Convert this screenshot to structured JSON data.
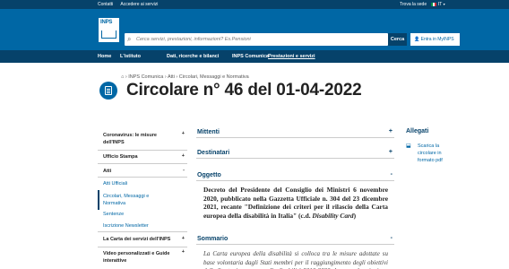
{
  "topbar": {
    "links": [
      "Contatti",
      "Accedere ai servizi"
    ],
    "right": "Trova la sede",
    "lang": "IT"
  },
  "header": {
    "logo_text": "INPS",
    "search_placeholder": "Cerca servizi, prestazioni, informazioni? Es.Pensioni",
    "search_button": "Cerca",
    "login_button": "Entra in MyINPS"
  },
  "nav": {
    "items": [
      "Home",
      "L'istituto",
      "Dati, ricerche e bilanci",
      "INPS Comunica",
      "Prestazioni e servizi"
    ]
  },
  "breadcrumb": [
    "INPS Comunica",
    "Atti",
    "Circolari, Messaggi e Normativa"
  ],
  "page_title": "Circolare n° 46 del 01-04-2022",
  "sidebar": {
    "items": [
      {
        "label": "Coronavirus: le misure dell'INPS",
        "type": "bold",
        "toggle": "+"
      },
      {
        "label": "Ufficio Stampa",
        "type": "bold",
        "toggle": "+"
      },
      {
        "label": "Atti",
        "type": "bold",
        "toggle": "-"
      },
      {
        "label": "Atti Ufficiali",
        "type": "sub"
      },
      {
        "label": "Circolari, Messaggi e Normativa",
        "type": "sub"
      },
      {
        "label": "Sentenze",
        "type": "sub"
      },
      {
        "label": "Iscrizione Newsletter",
        "type": "sub"
      },
      {
        "label": "La Carta dei servizi dell'INPS",
        "type": "bold",
        "toggle": "+"
      },
      {
        "label": "Video personalizzati e Guide interattive",
        "type": "bold",
        "toggle": "+"
      }
    ]
  },
  "sections": [
    {
      "label": "Mittenti",
      "toggle": "+"
    },
    {
      "label": "Destinatari",
      "toggle": "+"
    },
    {
      "label": "Oggetto",
      "toggle": "-"
    },
    {
      "label": "Sommario",
      "toggle": "-"
    }
  ],
  "oggetto": {
    "text_main": "Decreto del Presidente del Consiglio dei Ministri 6 novembre 2020, pubblicato nella Gazzetta Ufficiale n. 304 del 23 dicembre 2021, recante \"Definizione dei criteri per il rilascio della Carta europea della disabilità in Italia\" (c.d. ",
    "text_italic": "Disability Card",
    "text_end": ")"
  },
  "sommario": {
    "text": "La Carta europea della disabilità si colloca tra le misure adottate su base volontaria dagli Stati membri per il raggiungimento degli obiettivi della Strategia europea sulla disabilità 2010-2020 che prevede azioni"
  },
  "allegati": {
    "title": "Allegati",
    "item_label": "Scarica la circolare in formato pdf"
  }
}
